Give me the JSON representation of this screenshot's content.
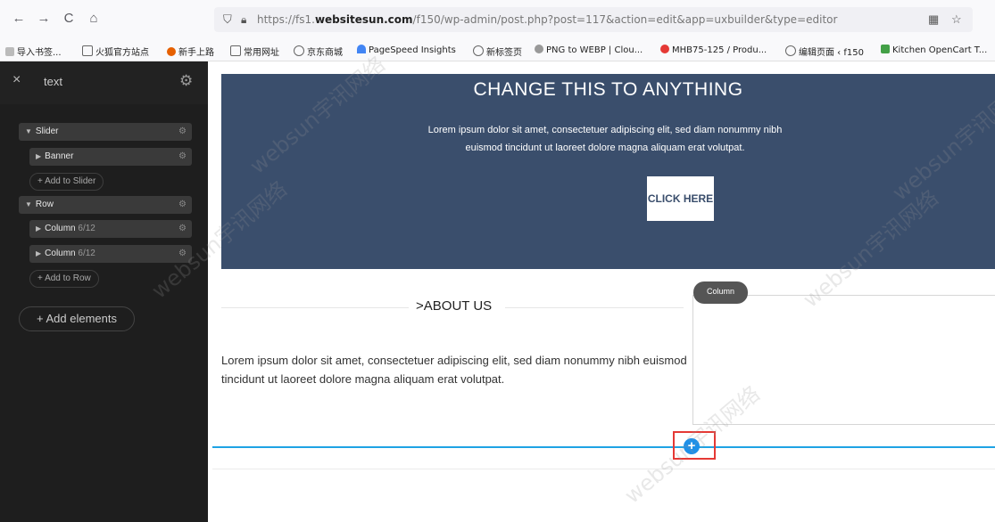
{
  "browser": {
    "back_icon": "←",
    "forward_icon": "→",
    "reload_icon": "C",
    "home_icon": "⌂",
    "url_prefix": "https://fs1.",
    "url_domain": "websitesun.com",
    "url_suffix": "/f150/wp-admin/post.php?post=117&action=edit&app=uxbuilder&type=editor",
    "qr_icon": "▦",
    "star_icon": "☆"
  },
  "bookmarks": [
    {
      "label": "导入书签...",
      "color": "#888"
    },
    {
      "label": "火狐官方站点",
      "color": "#888"
    },
    {
      "label": "新手上路",
      "color": "#e66000"
    },
    {
      "label": "常用网址",
      "color": "#888"
    },
    {
      "label": "京东商城",
      "color": "#888"
    },
    {
      "label": "PageSpeed Insights",
      "color": "#4285f4"
    },
    {
      "label": "新标签页",
      "color": "#888"
    },
    {
      "label": "PNG to WEBP | Clou...",
      "color": "#888"
    },
    {
      "label": "MHB75-125 / Produ...",
      "color": "#e53935"
    },
    {
      "label": "编辑页面 ‹ f150",
      "color": "#888"
    },
    {
      "label": "Kitchen OpenCart T...",
      "color": "#43a047"
    }
  ],
  "sidebar": {
    "close": "×",
    "title": "text",
    "gear": "⚙",
    "slider_label": "Slider",
    "banner_label": "Banner",
    "add_to_slider": "+ Add to Slider",
    "row_label": "Row",
    "column1_label": "Column",
    "column1_size": "6/12",
    "column2_label": "Column",
    "column2_size": "6/12",
    "add_to_row": "+ Add to Row",
    "add_elements": "+ Add elements"
  },
  "canvas": {
    "banner_title": "CHANGE THIS TO ANYTHING",
    "banner_text": "Lorem ipsum dolor sit amet, consectetuer adipiscing elit, sed diam nonummy nibh euismod tincidunt ut laoreet dolore magna aliquam erat volutpat.",
    "banner_button": "CLICK HERE",
    "about_title": "ABOUT US",
    "about_text": "Lorem ipsum dolor sit amet, consectetuer adipiscing elit, sed diam nonummy nibh euismod tincidunt ut laoreet dolore magna aliquam erat volutpat.",
    "column_tag": "Column",
    "plus": "+"
  },
  "watermark": "websun宇讯网络",
  "colors": {
    "banner_bg": "#3a4e6c",
    "accent_line": "#1ea3e4",
    "plus_button": "#1e90e8",
    "highlight_box": "#e53935"
  }
}
